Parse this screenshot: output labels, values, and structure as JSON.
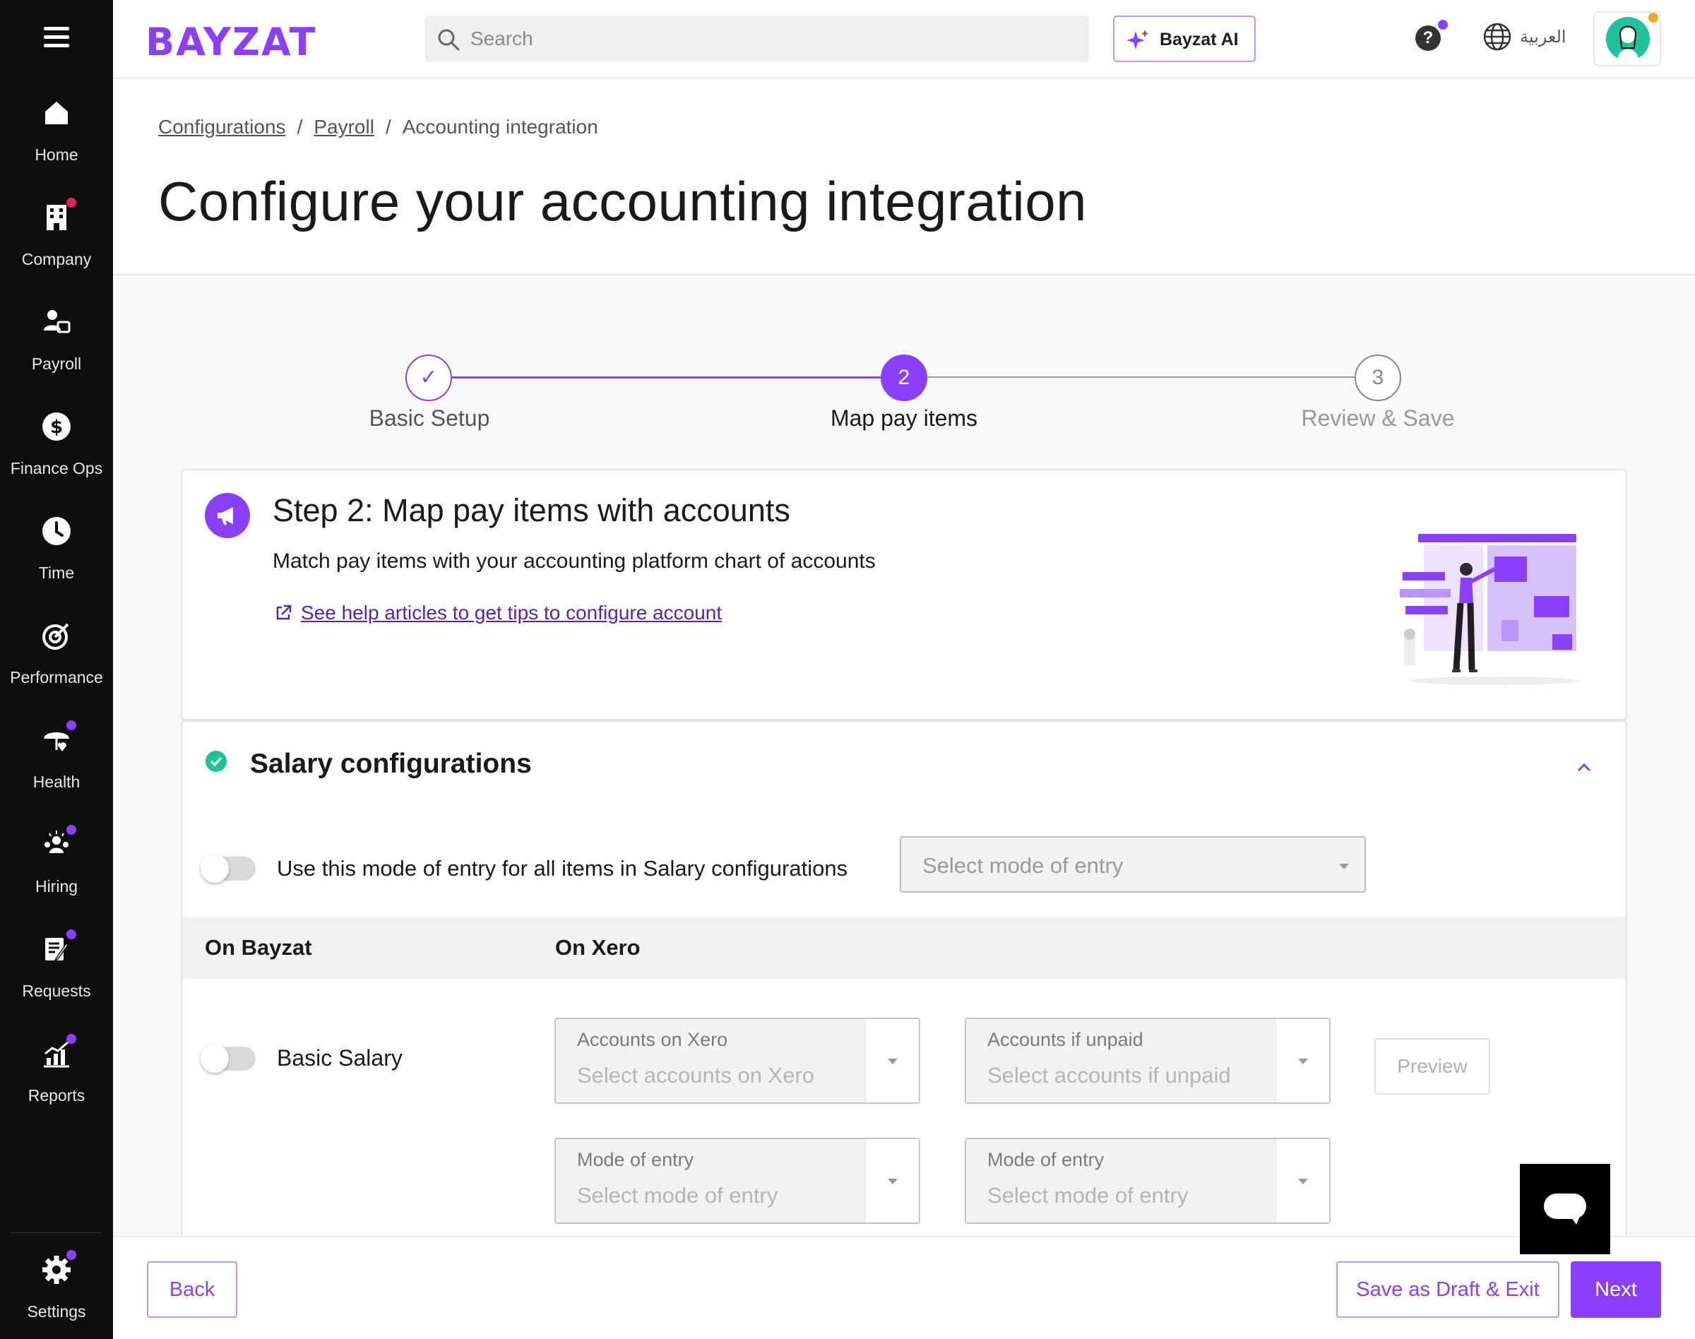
{
  "sidebar": {
    "items": [
      {
        "label": "Home",
        "icon": "home-icon"
      },
      {
        "label": "Company",
        "icon": "building-icon",
        "badge": "red"
      },
      {
        "label": "Payroll",
        "icon": "payroll-icon"
      },
      {
        "label": "Finance Ops",
        "icon": "dollar-icon"
      },
      {
        "label": "Time",
        "icon": "clock-icon"
      },
      {
        "label": "Performance",
        "icon": "target-icon"
      },
      {
        "label": "Health",
        "icon": "umbrella-heart-icon",
        "badge": "purple"
      },
      {
        "label": "Hiring",
        "icon": "people-icon",
        "badge": "purple"
      },
      {
        "label": "Requests",
        "icon": "clipboard-icon",
        "badge": "purple"
      },
      {
        "label": "Reports",
        "icon": "chart-icon",
        "badge": "purple"
      }
    ],
    "settings_label": "Settings"
  },
  "topbar": {
    "logo": "BAYZAT",
    "search_placeholder": "Search",
    "ai_label": "Bayzat AI",
    "help": "?",
    "language": "العربية"
  },
  "breadcrumb": {
    "items": [
      "Configurations",
      "Payroll"
    ],
    "current": "Accounting integration"
  },
  "page_title": "Configure your accounting integration",
  "stepper": {
    "steps": [
      {
        "number": "✓",
        "label": "Basic Setup",
        "state": "done"
      },
      {
        "number": "2",
        "label": "Map pay items",
        "state": "active"
      },
      {
        "number": "3",
        "label": "Review & Save",
        "state": "pending"
      }
    ]
  },
  "step_card": {
    "title": "Step 2: Map pay items with accounts",
    "subtitle": "Match pay items with your accounting platform chart of accounts",
    "help_link": "See help articles to get tips to configure account"
  },
  "salary": {
    "title": "Salary configurations",
    "use_mode_label": "Use this mode of entry for all items in Salary configurations",
    "select_mode_placeholder": "Select mode of entry",
    "col_bayzat": "On Bayzat",
    "col_xero": "On Xero",
    "row": {
      "label": "Basic Salary",
      "accounts_label": "Accounts on Xero",
      "accounts_placeholder": "Select accounts on Xero",
      "unpaid_label": "Accounts if unpaid",
      "unpaid_placeholder": "Select accounts if unpaid",
      "mode1_label": "Mode of entry",
      "mode1_placeholder": "Select mode of entry",
      "mode2_label": "Mode of entry",
      "mode2_placeholder": "Select mode of entry",
      "preview": "Preview"
    }
  },
  "footer": {
    "back": "Back",
    "save_draft": "Save as Draft & Exit",
    "next": "Next"
  },
  "colors": {
    "accent": "#8a3ffc",
    "sidebar": "#0e0e0e",
    "success": "#1ec39a"
  }
}
